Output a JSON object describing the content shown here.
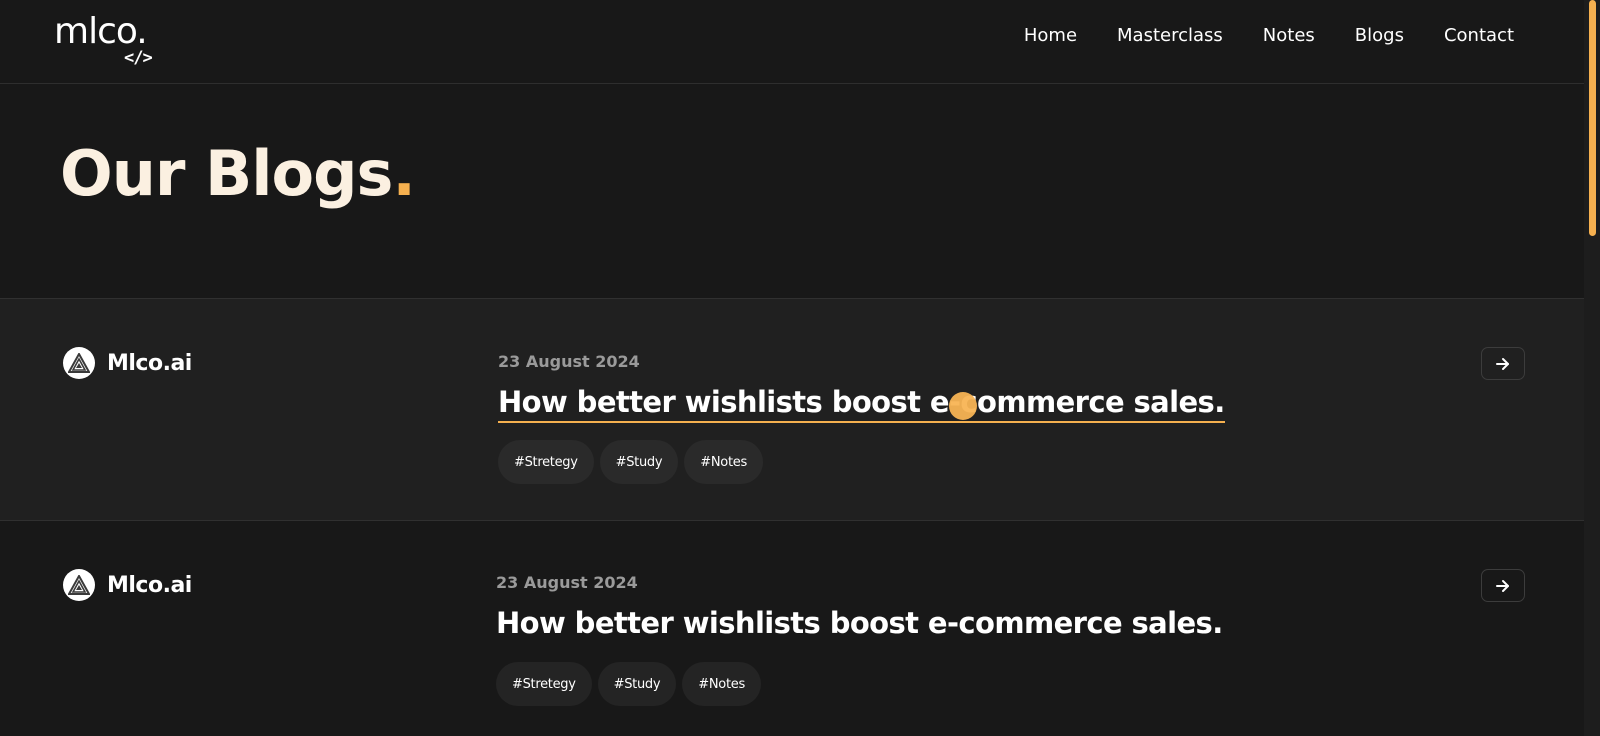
{
  "header": {
    "logo_text": "mlco.",
    "logo_code": "</>",
    "nav": [
      "Home",
      "Masterclass",
      "Notes",
      "Blogs",
      "Contact"
    ]
  },
  "hero": {
    "title": "Our Blogs",
    "dot": "."
  },
  "posts": [
    {
      "author": "Mlco.ai",
      "date": "23 August 2024",
      "title": "How better wishlists boost e-commerce sales.",
      "tags": [
        "#Stretegy",
        "#Study",
        "#Notes"
      ]
    },
    {
      "author": "Mlco.ai",
      "date": "23 August 2024",
      "title": "How better wishlists boost e-commerce sales.",
      "tags": [
        "#Stretegy",
        "#Study",
        "#Notes"
      ]
    }
  ],
  "icons": {
    "avatar": "triangle-logo-icon",
    "arrow": "arrow-right-icon"
  },
  "colors": {
    "accent": "#f5b04f",
    "background": "#181818",
    "hero_text": "#fbf0e1"
  }
}
